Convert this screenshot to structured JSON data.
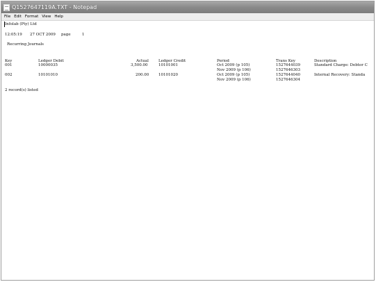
{
  "window": {
    "title": "Q1527647119A.TXT - Notepad"
  },
  "menu": [
    "File",
    "Edit",
    "Format",
    "View",
    "Help"
  ],
  "document": {
    "company": "Infolab (Pty) Ltd",
    "time": "12:05:19",
    "date": "27 OCT 2009",
    "page_label": "page",
    "page_number": "1",
    "report_title": "Recurring Journals",
    "columns": [
      "Key",
      "Ledger Debit",
      "Actual",
      "Ledger Credit",
      "Period",
      "Trans Key",
      "Description"
    ],
    "rows": [
      {
        "key": "001",
        "ledger_debit": "10000035",
        "actual": "3,500.00",
        "ledger_credit": "10101001",
        "period": "Oct 2009 (p 105)",
        "trans_key": "1527644039",
        "description": "Standard Charge: Debtor C"
      },
      {
        "key": "",
        "ledger_debit": "",
        "actual": "",
        "ledger_credit": "",
        "period": "Nov 2009 (p 106)",
        "trans_key": "1527646303",
        "description": ""
      },
      {
        "key": "002",
        "ledger_debit": "10101010",
        "actual": "200.00",
        "ledger_credit": "10101020",
        "period": "Oct 2009 (p 105)",
        "trans_key": "1527644040",
        "description": "Internal Recovery: Standa"
      },
      {
        "key": "",
        "ledger_debit": "",
        "actual": "",
        "ledger_credit": "",
        "period": "Nov 2009 (p 106)",
        "trans_key": "1527646304",
        "description": ""
      }
    ],
    "footer": "2 record(s) listed"
  }
}
